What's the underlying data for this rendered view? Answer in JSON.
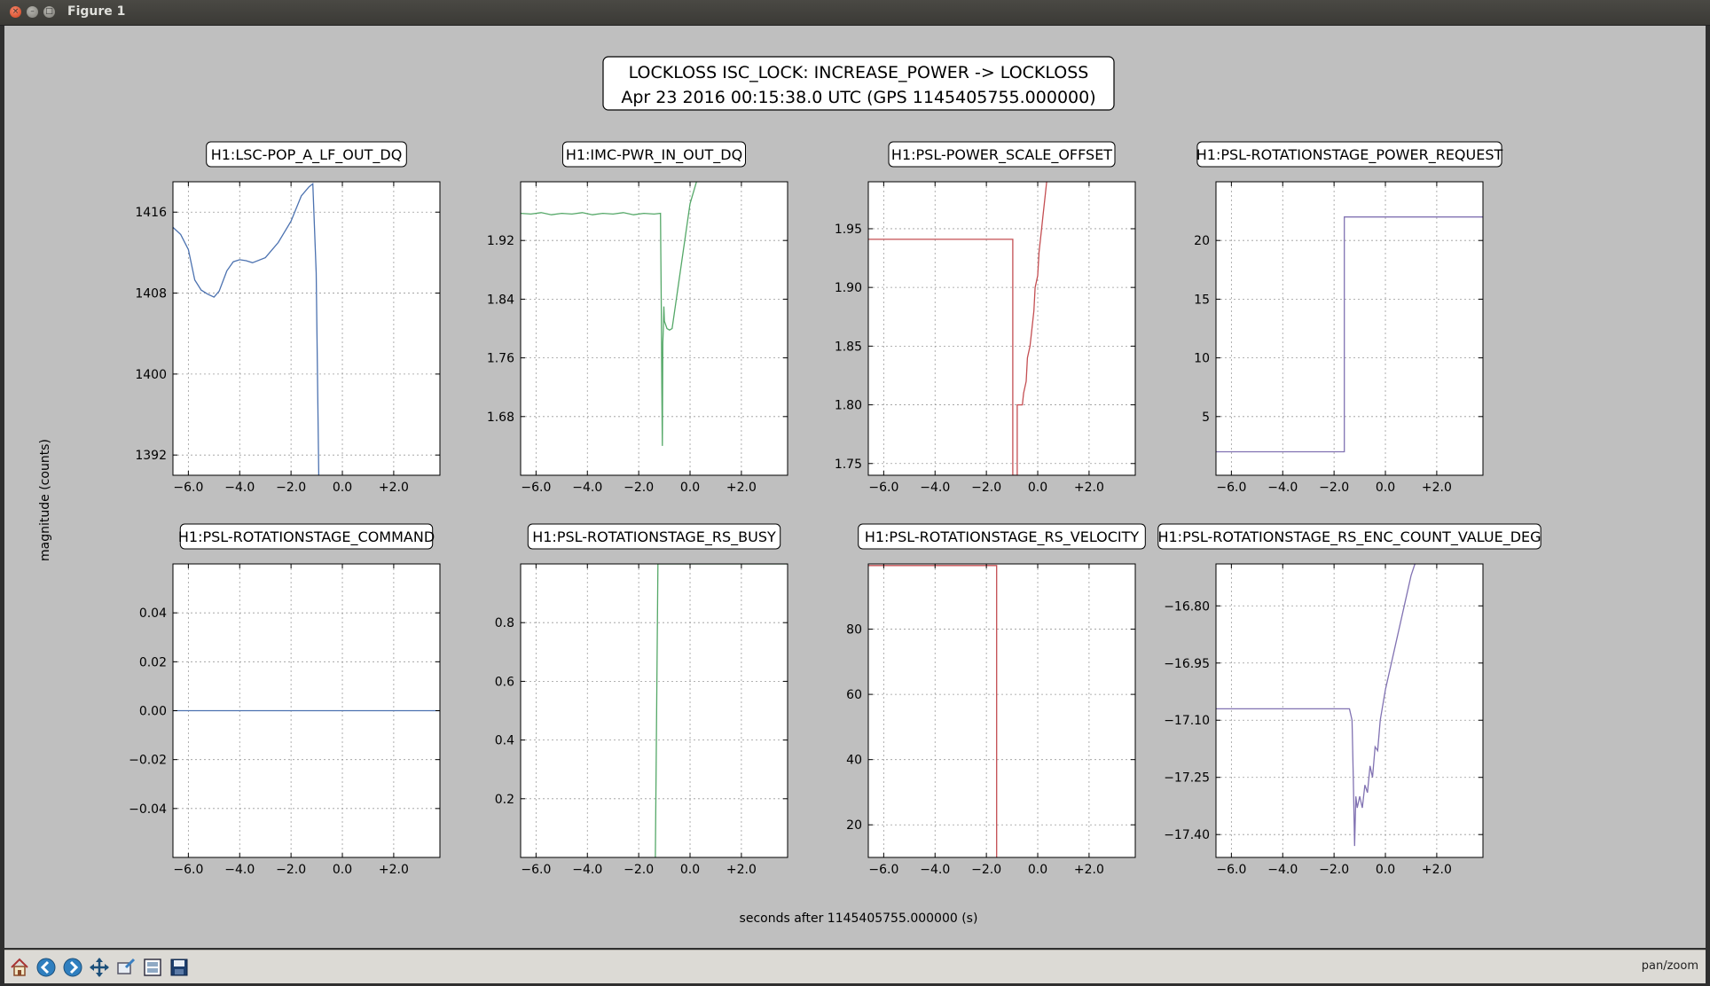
{
  "window": {
    "title": "Figure 1"
  },
  "figure": {
    "title_line1": "LOCKLOSS ISC_LOCK: INCREASE_POWER -> LOCKLOSS",
    "title_line2": "Apr 23 2016 00:15:38.0 UTC (GPS 1145405755.000000)",
    "ylabel": "magnitude (counts)",
    "xlabel": "seconds after 1145405755.000000 (s)"
  },
  "toolbar": {
    "buttons": [
      "home-icon",
      "back-arrow-icon",
      "forward-arrow-icon",
      "pan-move-icon",
      "zoom-rect-icon",
      "configure-subplots-icon",
      "save-floppy-icon"
    ],
    "mode": "pan/zoom"
  },
  "chart_data": [
    {
      "type": "line",
      "title": "H1:LSC-POP_A_LF_OUT_DQ",
      "color": "#4c72b0",
      "xlim": [
        -6.6,
        3.8
      ],
      "ylim": [
        1390,
        1419
      ],
      "xticks": [
        -6,
        -4,
        -2,
        0,
        2
      ],
      "xtick_labels": [
        "−6.0",
        "−4.0",
        "−2.0",
        "0.0",
        "+2.0"
      ],
      "yticks": [
        1392,
        1400,
        1408,
        1416
      ],
      "ytick_labels": [
        "1392",
        "1400",
        "1408",
        "1416"
      ],
      "x": [
        -6.6,
        -6.3,
        -6.0,
        -5.75,
        -5.5,
        -5.25,
        -5.0,
        -4.8,
        -4.5,
        -4.25,
        -4.0,
        -3.75,
        -3.5,
        -3.0,
        -2.5,
        -2.0,
        -1.6,
        -1.3,
        -1.15,
        -1.02,
        -0.92
      ],
      "y": [
        1414.5,
        1413.8,
        1412.3,
        1409.3,
        1408.3,
        1407.9,
        1407.6,
        1408.2,
        1410.2,
        1411.1,
        1411.3,
        1411.2,
        1411.0,
        1411.5,
        1413.0,
        1415.1,
        1417.6,
        1418.5,
        1418.8,
        1410.0,
        1390.0
      ]
    },
    {
      "type": "line",
      "title": "H1:IMC-PWR_IN_OUT_DQ",
      "color": "#55a868",
      "xlim": [
        -6.6,
        3.8
      ],
      "ylim": [
        1.6,
        2.0
      ],
      "xticks": [
        -6,
        -4,
        -2,
        0,
        2
      ],
      "xtick_labels": [
        "−6.0",
        "−4.0",
        "−2.0",
        "0.0",
        "+2.0"
      ],
      "yticks": [
        1.68,
        1.76,
        1.84,
        1.92
      ],
      "ytick_labels": [
        "1.68",
        "1.76",
        "1.84",
        "1.92"
      ],
      "x": [
        -6.6,
        -6.2,
        -5.8,
        -5.4,
        -5.0,
        -4.6,
        -4.2,
        -3.8,
        -3.4,
        -3.0,
        -2.6,
        -2.2,
        -1.8,
        -1.4,
        -1.15,
        -1.14,
        -1.12,
        -1.1,
        -1.08,
        -1.06,
        -1.04,
        -1.02,
        -1.0,
        -0.9,
        -0.8,
        -0.7,
        0.0,
        0.25
      ],
      "y": [
        1.957,
        1.956,
        1.958,
        1.955,
        1.957,
        1.956,
        1.958,
        1.955,
        1.957,
        1.956,
        1.958,
        1.955,
        1.957,
        1.956,
        1.957,
        1.91,
        1.83,
        1.72,
        1.64,
        1.78,
        1.8,
        1.83,
        1.81,
        1.8,
        1.798,
        1.8,
        1.97,
        2.0
      ]
    },
    {
      "type": "line",
      "title": "H1:PSL-POWER_SCALE_OFFSET",
      "color": "#c44e52",
      "xlim": [
        -6.6,
        3.8
      ],
      "ylim": [
        1.74,
        1.99
      ],
      "xticks": [
        -6,
        -4,
        -2,
        0,
        2
      ],
      "xtick_labels": [
        "−6.0",
        "−4.0",
        "−2.0",
        "0.0",
        "+2.0"
      ],
      "yticks": [
        1.75,
        1.8,
        1.85,
        1.9,
        1.95
      ],
      "ytick_labels": [
        "1.75",
        "1.80",
        "1.85",
        "1.90",
        "1.95"
      ],
      "x": [
        -6.6,
        -0.97,
        -0.97,
        -0.8,
        -0.8,
        -0.6,
        -0.55,
        -0.45,
        -0.4,
        -0.3,
        -0.25,
        -0.15,
        -0.1,
        0.0,
        0.05,
        0.15,
        0.2,
        0.3,
        0.35
      ],
      "y": [
        1.941,
        1.941,
        1.74,
        1.74,
        1.8,
        1.8,
        1.81,
        1.82,
        1.84,
        1.85,
        1.86,
        1.88,
        1.9,
        1.91,
        1.93,
        1.95,
        1.96,
        1.98,
        1.99
      ]
    },
    {
      "type": "line",
      "title": "H1:PSL-ROTATIONSTAGE_POWER_REQUEST",
      "color": "#8172b2",
      "xlim": [
        -6.6,
        3.8
      ],
      "ylim": [
        0,
        25
      ],
      "xticks": [
        -6,
        -4,
        -2,
        0,
        2
      ],
      "xtick_labels": [
        "−6.0",
        "−4.0",
        "−2.0",
        "0.0",
        "+2.0"
      ],
      "yticks": [
        5,
        10,
        15,
        20
      ],
      "ytick_labels": [
        "5",
        "10",
        "15",
        "20"
      ],
      "x": [
        -6.6,
        -1.6,
        -1.6,
        3.8
      ],
      "y": [
        2,
        2,
        22,
        22
      ]
    },
    {
      "type": "line",
      "title": "H1:PSL-ROTATIONSTAGE_COMMAND",
      "color": "#4c72b0",
      "xlim": [
        -6.6,
        3.8
      ],
      "ylim": [
        -0.06,
        0.06
      ],
      "xticks": [
        -6,
        -4,
        -2,
        0,
        2
      ],
      "xtick_labels": [
        "−6.0",
        "−4.0",
        "−2.0",
        "0.0",
        "+2.0"
      ],
      "yticks": [
        -0.04,
        -0.02,
        0.0,
        0.02,
        0.04
      ],
      "ytick_labels": [
        "−0.04",
        "−0.02",
        "0.00",
        "0.02",
        "0.04"
      ],
      "x": [
        -6.6,
        3.8
      ],
      "y": [
        0,
        0
      ]
    },
    {
      "type": "line",
      "title": "H1:PSL-ROTATIONSTAGE_RS_BUSY",
      "color": "#55a868",
      "xlim": [
        -6.6,
        3.8
      ],
      "ylim": [
        0,
        1
      ],
      "xticks": [
        -6,
        -4,
        -2,
        0,
        2
      ],
      "xtick_labels": [
        "−6.0",
        "−4.0",
        "−2.0",
        "0.0",
        "+2.0"
      ],
      "yticks": [
        0.2,
        0.4,
        0.6,
        0.8
      ],
      "ytick_labels": [
        "0.2",
        "0.4",
        "0.6",
        "0.8"
      ],
      "x": [
        -1.35,
        -1.25,
        3.8
      ],
      "y": [
        0,
        1,
        1
      ]
    },
    {
      "type": "line",
      "title": "H1:PSL-ROTATIONSTAGE_RS_VELOCITY",
      "color": "#c44e52",
      "xlim": [
        -6.6,
        3.8
      ],
      "ylim": [
        10,
        100
      ],
      "xticks": [
        -6,
        -4,
        -2,
        0,
        2
      ],
      "xtick_labels": [
        "−6.0",
        "−4.0",
        "−2.0",
        "0.0",
        "+2.0"
      ],
      "yticks": [
        20,
        40,
        60,
        80
      ],
      "ytick_labels": [
        "20",
        "40",
        "60",
        "80"
      ],
      "x": [
        -6.6,
        -1.6,
        -1.6
      ],
      "y": [
        99.5,
        99.5,
        10
      ]
    },
    {
      "type": "line",
      "title": "H1:PSL-ROTATIONSTAGE_RS_ENC_COUNT_VALUE_DEG",
      "color": "#8172b2",
      "xlim": [
        -6.6,
        3.8
      ],
      "ylim": [
        -17.46,
        -16.69
      ],
      "xticks": [
        -6,
        -4,
        -2,
        0,
        2
      ],
      "xtick_labels": [
        "−6.0",
        "−4.0",
        "−2.0",
        "0.0",
        "+2.0"
      ],
      "yticks": [
        -17.4,
        -17.25,
        -17.1,
        -16.95,
        -16.8
      ],
      "ytick_labels": [
        "−17.40",
        "−17.25",
        "−17.10",
        "−16.95",
        "−16.80"
      ],
      "x": [
        -6.6,
        -1.4,
        -1.3,
        -1.25,
        -1.2,
        -1.15,
        -1.1,
        -1.0,
        -0.9,
        -0.8,
        -0.7,
        -0.6,
        -0.5,
        -0.4,
        -0.3,
        -0.2,
        0.0,
        0.2,
        0.4,
        0.6,
        0.8,
        1.0,
        1.15
      ],
      "y": [
        -17.07,
        -17.07,
        -17.1,
        -17.25,
        -17.43,
        -17.3,
        -17.33,
        -17.3,
        -17.33,
        -17.27,
        -17.29,
        -17.22,
        -17.25,
        -17.17,
        -17.18,
        -17.1,
        -17.02,
        -16.96,
        -16.9,
        -16.84,
        -16.78,
        -16.72,
        -16.69
      ]
    }
  ]
}
